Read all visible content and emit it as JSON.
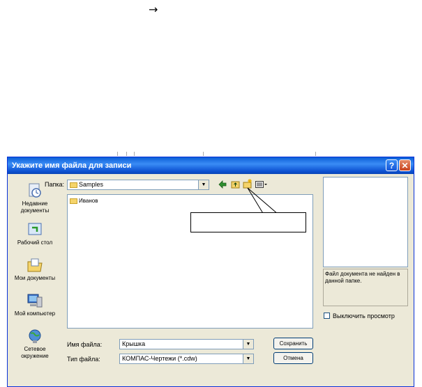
{
  "page": {
    "arrow": "→"
  },
  "dialog": {
    "title": "Укажите имя файла для записи",
    "help_glyph": "?",
    "close_glyph": "✕",
    "folder_label": "Папка:",
    "folder_value": "Samples",
    "places": [
      {
        "label_1": "Недавние",
        "label_2": "документы"
      },
      {
        "label_1": "Рабочий стол"
      },
      {
        "label_1": "Мои документы"
      },
      {
        "label_1": "Мой компьютер"
      },
      {
        "label_1": "Сетевое",
        "label_2": "окружение"
      }
    ],
    "files": [
      {
        "name": "Иванов"
      }
    ],
    "filename_label": "Имя файла:",
    "filename_value": "Крышка",
    "filetype_label": "Тип файла:",
    "filetype_value": "КОМПАС-Чертежи (*.cdw)",
    "save_label": "Сохранить",
    "cancel_label": "Отмена",
    "preview_message": "Файл документа не найден в данной папке.",
    "preview_toggle_label": "Выключить просмотр"
  }
}
